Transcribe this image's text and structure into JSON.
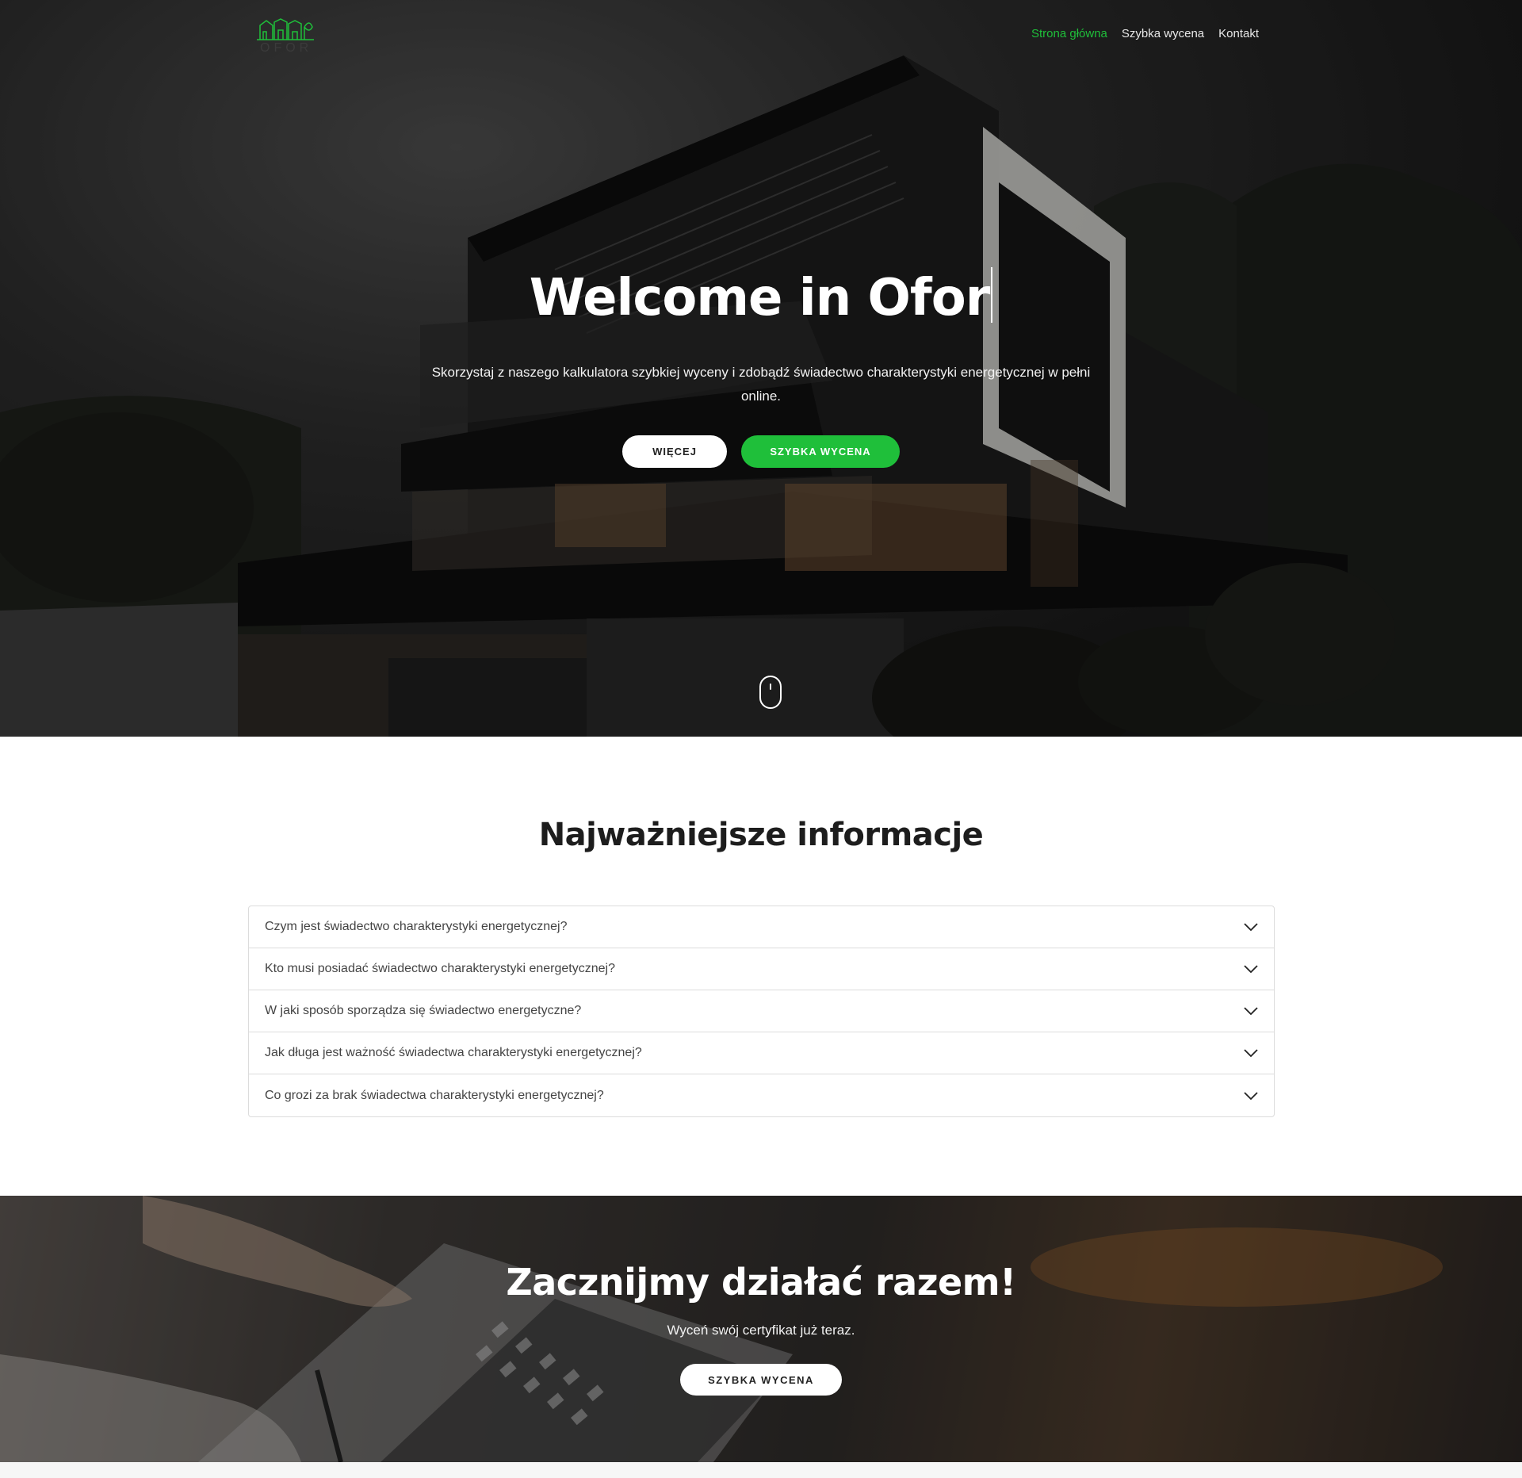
{
  "brand": {
    "logo_text": "OFOR",
    "accent_color": "#1fbf3a"
  },
  "nav": {
    "items": [
      {
        "label": "Strona główna",
        "active": true
      },
      {
        "label": "Szybka wycena",
        "active": false
      },
      {
        "label": "Kontakt",
        "active": false
      }
    ]
  },
  "hero": {
    "title": "Welcome in Ofor",
    "subtitle": "Skorzystaj z naszego kalkulatora szybkiej wyceny i zdobądź świadectwo charakterystyki energetycznej w pełni online.",
    "more_button": "WIĘCEJ",
    "quote_button": "SZYBKA WYCENA"
  },
  "info": {
    "title": "Najważniejsze informacje",
    "questions": [
      "Czym jest świadectwo charakterystyki energetycznej?",
      "Kto musi posiadać świadectwo charakterystyki energetycznej?",
      "W jaki sposób sporządza się świadectwo energetyczne?",
      "Jak długa jest ważność świadectwa charakterystyki energetycznej?",
      "Co grozi za brak świadectwa charakterystyki energetycznej?"
    ]
  },
  "cta": {
    "title": "Zacznijmy działać razem!",
    "subtitle": "Wyceń swój certyfikat już teraz.",
    "button": "SZYBKA WYCENA"
  }
}
